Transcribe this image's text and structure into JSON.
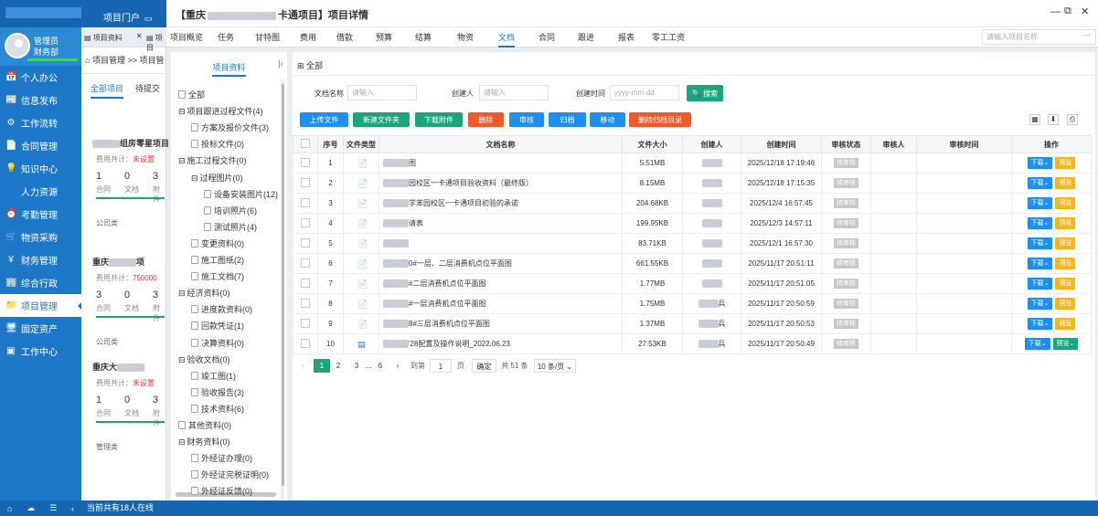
{
  "sidebar": {
    "user_name": "管理员",
    "user_dept": "财务部",
    "portal_label": "项目门户",
    "items": [
      {
        "icon": "📅",
        "label": "个人办公"
      },
      {
        "icon": "📰",
        "label": "信息发布"
      },
      {
        "icon": "⚙",
        "label": "工作流转"
      },
      {
        "icon": "📄",
        "label": "合同管理"
      },
      {
        "icon": "💡",
        "label": "知识中心"
      },
      {
        "icon": "👤",
        "label": "人力资源"
      },
      {
        "icon": "⏰",
        "label": "考勤管理"
      },
      {
        "icon": "🛒",
        "label": "物资采购"
      },
      {
        "icon": "¥",
        "label": "财务管理"
      },
      {
        "icon": "🏢",
        "label": "综合行政"
      },
      {
        "icon": "📁",
        "label": "项目管理"
      },
      {
        "icon": "🖥",
        "label": "固定资产"
      },
      {
        "icon": "▣",
        "label": "工作中心"
      }
    ],
    "active_index": 10,
    "online_text": "当前共有18人在线"
  },
  "tabs": [
    {
      "label": "项目资料"
    },
    {
      "label": "项目"
    }
  ],
  "col2": {
    "breadcrumb": "项目管理 >> 项目管",
    "subtabs": [
      "全部项目",
      "待提交"
    ],
    "cards": [
      {
        "title_suffix": "组房零星项目",
        "fee_label": "费用共计：",
        "fee_value": "未设置",
        "counts": [
          "1",
          "0",
          "3"
        ],
        "count_labels": [
          "合同",
          "文档",
          "附件"
        ],
        "footer": "公司类"
      },
      {
        "title_prefix": "重庆",
        "title_suffix": "项",
        "fee_label": "费用共计：",
        "fee_value": "750000",
        "counts": [
          "3",
          "0",
          "3"
        ],
        "count_labels": [
          "合同",
          "文档",
          "附件"
        ],
        "footer": "公司类"
      },
      {
        "title_prefix": "重庆大",
        "title_suffix": "",
        "fee_label": "费用共计：",
        "fee_value": "未设置",
        "counts": [
          "1",
          "0",
          "3"
        ],
        "count_labels": [
          "合同",
          "文档",
          "附件"
        ],
        "footer": "管理类"
      }
    ]
  },
  "header": {
    "title_left": "【重庆",
    "title_right": "卡通项目】项目详情",
    "search_placeholder": "请输入项目名称"
  },
  "menu": [
    "项目概览",
    "任务",
    "甘特图",
    "费用",
    "借款",
    "预算",
    "结算",
    "物资",
    "文档",
    "合同",
    "跟进",
    "报表",
    "零工工资"
  ],
  "menu_active": 8,
  "tree": {
    "title": "项目资料",
    "nodes": [
      {
        "label": "全部",
        "depth": 0,
        "toggle": ""
      },
      {
        "label": "项目跟进过程文件(4)",
        "depth": 0,
        "toggle": "⊟"
      },
      {
        "label": "方案及报价文件(3)",
        "depth": 1,
        "toggle": ""
      },
      {
        "label": "投标文件(0)",
        "depth": 1,
        "toggle": ""
      },
      {
        "label": "施工过程文件(0)",
        "depth": 0,
        "toggle": "⊟"
      },
      {
        "label": "过程图片(0)",
        "depth": 1,
        "toggle": "⊟"
      },
      {
        "label": "设备安装图片(12)",
        "depth": 2,
        "toggle": ""
      },
      {
        "label": "培训照片(6)",
        "depth": 2,
        "toggle": ""
      },
      {
        "label": "测试照片(4)",
        "depth": 2,
        "toggle": ""
      },
      {
        "label": "变更资料(0)",
        "depth": 1,
        "toggle": ""
      },
      {
        "label": "施工图纸(2)",
        "depth": 1,
        "toggle": ""
      },
      {
        "label": "施工文档(7)",
        "depth": 1,
        "toggle": ""
      },
      {
        "label": "经济资料(0)",
        "depth": 0,
        "toggle": "⊟"
      },
      {
        "label": "进度款资料(0)",
        "depth": 1,
        "toggle": ""
      },
      {
        "label": "回款凭证(1)",
        "depth": 1,
        "toggle": ""
      },
      {
        "label": "决算资料(0)",
        "depth": 1,
        "toggle": ""
      },
      {
        "label": "验收文档(0)",
        "depth": 0,
        "toggle": "⊟"
      },
      {
        "label": "竣工图(1)",
        "depth": 1,
        "toggle": ""
      },
      {
        "label": "验收报告(3)",
        "depth": 1,
        "toggle": ""
      },
      {
        "label": "技术资料(6)",
        "depth": 1,
        "toggle": ""
      },
      {
        "label": "其他资料(0)",
        "depth": 0,
        "toggle": ""
      },
      {
        "label": "财务资料(0)",
        "depth": 0,
        "toggle": "⊟"
      },
      {
        "label": "外经证办理(0)",
        "depth": 1,
        "toggle": ""
      },
      {
        "label": "外经证完税证明(0)",
        "depth": 1,
        "toggle": ""
      },
      {
        "label": "外经证反馈(0)",
        "depth": 1,
        "toggle": ""
      }
    ]
  },
  "main": {
    "all_label": "全部",
    "filters": {
      "name_label": "文档名称",
      "name_placeholder": "请输入",
      "creator_label": "创建人",
      "creator_placeholder": "请输入",
      "time_label": "创建时间",
      "time_placeholder": "yyyy-mm-dd",
      "search_btn": "搜索"
    },
    "toolbar": [
      {
        "label": "上传文件",
        "color": "#1d8ff0"
      },
      {
        "label": "新建文件夹",
        "color": "#1aa67b"
      },
      {
        "label": "下载附件",
        "color": "#1aa67b"
      },
      {
        "label": "删除",
        "color": "#f05a28"
      },
      {
        "label": "审核",
        "color": "#1d8ff0"
      },
      {
        "label": "归档",
        "color": "#1d8ff0"
      },
      {
        "label": "移动",
        "color": "#1d8ff0"
      },
      {
        "label": "删除归档目录",
        "color": "#f05a28"
      }
    ],
    "columns": [
      "序号",
      "文件类型",
      "文档名称",
      "文件大小",
      "创建人",
      "创建时间",
      "审核状态",
      "审核人",
      "审核时间",
      "操作"
    ],
    "rows": [
      {
        "no": "1",
        "name": "图",
        "size": "5.51MB",
        "creator": "",
        "time": "2025/12/18 17:19:46",
        "status": "待审核",
        "type": "pdf"
      },
      {
        "no": "2",
        "name": "园校区一卡通项目验收资料（最终版）",
        "size": "8.15MB",
        "creator": "",
        "time": "2025/12/18 17:15:35",
        "status": "待审核",
        "type": "pdf"
      },
      {
        "no": "3",
        "name": "学苯园校区一卡通项目初验的承诺",
        "size": "204.68KB",
        "creator": "",
        "time": "2025/12/4 16:57:45",
        "status": "待审核",
        "type": "pdf"
      },
      {
        "no": "4",
        "name": "请表",
        "size": "199.95KB",
        "creator": "",
        "time": "2025/12/3 14:57:11",
        "status": "待审核",
        "type": "pdf"
      },
      {
        "no": "5",
        "name": "",
        "size": "83.71KB",
        "creator": "",
        "time": "2025/12/1 16:57:30",
        "status": "待审核",
        "type": "pdf"
      },
      {
        "no": "6",
        "name": "0#一层、二层消费机点位平面图",
        "size": "661.55KB",
        "creator": "",
        "time": "2025/11/17 20:51:11",
        "status": "待审核",
        "type": "pdf"
      },
      {
        "no": "7",
        "name": "#二层消费机点位平面图",
        "size": "1.77MB",
        "creator": "",
        "time": "2025/11/17 20:51:05",
        "status": "待审核",
        "type": "pdf"
      },
      {
        "no": "8",
        "name": "#一层消费机点位平面图",
        "size": "1.75MB",
        "creator": "兵",
        "time": "2025/11/17 20:50:59",
        "status": "待审核",
        "type": "pdf"
      },
      {
        "no": "9",
        "name": "8#三层消费机点位平面图",
        "size": "1.37MB",
        "creator": "兵",
        "time": "2025/11/17 20:50:53",
        "status": "待审核",
        "type": "pdf"
      },
      {
        "no": "10",
        "name": "'28配置及操作说明_2022.06.23",
        "size": "27.53KB",
        "creator": "兵",
        "time": "2025/11/17 20:50:49",
        "status": "待审核",
        "type": "doc"
      }
    ],
    "row_download": "下载",
    "row_preview": "预览",
    "pagination": {
      "pages": [
        "1",
        "2",
        "3",
        "...",
        "6"
      ],
      "goto_label": "到第",
      "page_value": "1",
      "page_unit": "页",
      "confirm": "确定",
      "total": "共 51 条",
      "page_size": "10 条/页"
    }
  }
}
